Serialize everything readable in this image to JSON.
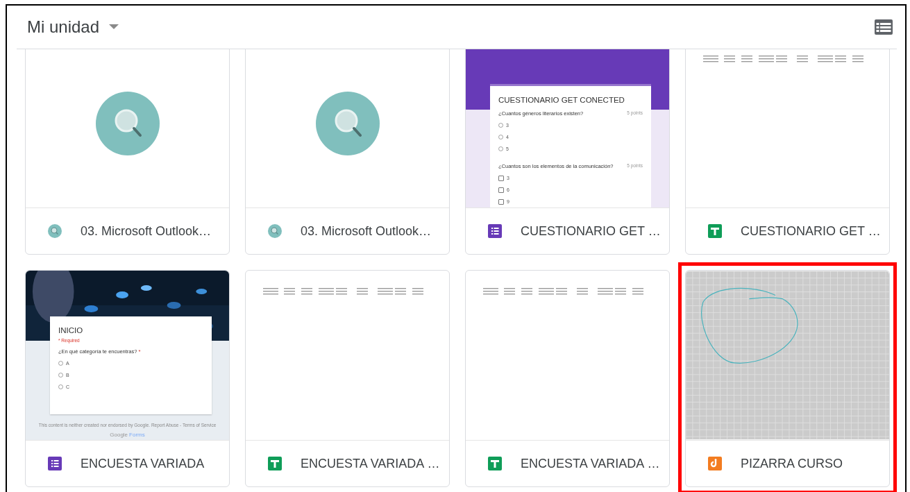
{
  "header": {
    "title": "Mi unidad"
  },
  "files": [
    {
      "name": "03. Microsoft Outlook…",
      "kind": "search",
      "highlighted": false,
      "preview": {
        "kind": "search"
      }
    },
    {
      "name": "03. Microsoft Outlook…",
      "kind": "search",
      "highlighted": false,
      "preview": {
        "kind": "search"
      }
    },
    {
      "name": "CUESTIONARIO GET …",
      "kind": "form",
      "highlighted": false,
      "preview": {
        "kind": "form",
        "header": {
          "kind": "band"
        },
        "title": "CUESTIONARIO GET CONECTED",
        "questions": [
          {
            "text": "¿Cuantos géneros literarios existen?",
            "points": "5 points",
            "options": [
              {
                "kind": "radio",
                "label": "3",
                "checked": false
              },
              {
                "kind": "radio",
                "label": "4",
                "checked": false
              },
              {
                "kind": "radio",
                "label": "5",
                "checked": false
              }
            ]
          },
          {
            "text": "¿Cuantos son los elementos de la comunicación?",
            "points": "5 points",
            "options": [
              {
                "kind": "checkbox",
                "label": "3",
                "checked": false
              },
              {
                "kind": "checkbox",
                "label": "6",
                "checked": false
              },
              {
                "kind": "checkbox",
                "label": "9",
                "checked": false
              }
            ]
          }
        ]
      }
    },
    {
      "name": "CUESTIONARIO GET …",
      "kind": "sheet",
      "highlighted": false,
      "preview": {
        "kind": "sheet"
      }
    },
    {
      "name": "ENCUESTA VARIADA",
      "kind": "form",
      "highlighted": false,
      "preview": {
        "kind": "form",
        "title": "INICIO",
        "required_note": "* Required",
        "questions": [
          {
            "text": "¿En qué categoría te encuentras?",
            "required_mark": "*",
            "options": [
              {
                "kind": "radio",
                "label": "A",
                "checked": false
              },
              {
                "kind": "radio",
                "label": "B",
                "checked": false
              },
              {
                "kind": "radio",
                "label": "C",
                "checked": false
              }
            ]
          }
        ],
        "footer": "This content is neither created nor endorsed by Google. Report Abuse - Terms of Service",
        "brand": {
          "name": "Google",
          "product": "Forms"
        }
      }
    },
    {
      "name": "ENCUESTA VARIADA …",
      "kind": "sheet",
      "highlighted": false,
      "preview": {
        "kind": "sheet"
      }
    },
    {
      "name": "ENCUESTA VARIADA …",
      "kind": "sheet",
      "highlighted": false,
      "preview": {
        "kind": "sheet"
      }
    },
    {
      "name": "PIZARRA CURSO",
      "kind": "jam",
      "highlighted": true,
      "preview": {
        "kind": "whiteboard"
      }
    }
  ]
}
